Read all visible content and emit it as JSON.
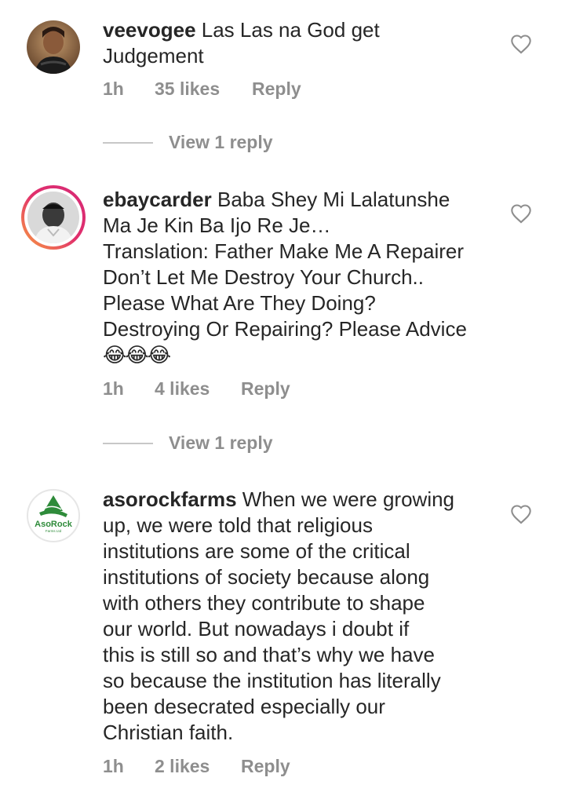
{
  "comments": [
    {
      "username": "veevogee",
      "lines": [
        "Las Las na God get",
        "Judgement"
      ],
      "time": "1h",
      "likes": "35 likes",
      "reply": "Reply",
      "view_replies": "View 1 reply",
      "avatar_colors": {
        "bg": "#7a5a40",
        "ring": "none"
      }
    },
    {
      "username": "ebaycarder",
      "lines": [
        "Baba Shey Mi Lalatunshe",
        "Ma Je Kin Ba Ijo Re Je…",
        "Translation: Father Make Me A Repairer",
        "Don’t Let Me Destroy Your Church..",
        "Please What Are They Doing?",
        "Destroying Or Repairing? Please Advice"
      ],
      "emoji_line": "😂😂😂",
      "time": "1h",
      "likes": "4 likes",
      "reply": "Reply",
      "view_replies": "View 1 reply"
    },
    {
      "username": "asorockfarms",
      "lines": [
        "When we were growing",
        "up, we were told that religious",
        "institutions are some of the critical",
        "institutions of society because along",
        "with others they contribute to shape",
        "our world. But nowadays i doubt if",
        "this is still so and that’s why we have",
        "so because the institution has literally",
        "been desecrated especially our",
        "Christian faith."
      ],
      "time": "1h",
      "likes": "2 likes",
      "reply": "Reply",
      "logo_text": "AsoRock",
      "logo_sub": "Farms Ltd"
    }
  ],
  "colors": {
    "text": "#262626",
    "muted": "#8e8e8e",
    "divider": "#c7c7c7",
    "story_ring_start": "#f9a03f",
    "story_ring_end": "#d62976",
    "logo_green": "#2e8b3a"
  },
  "icons": {
    "like": "heart-outline-icon"
  }
}
